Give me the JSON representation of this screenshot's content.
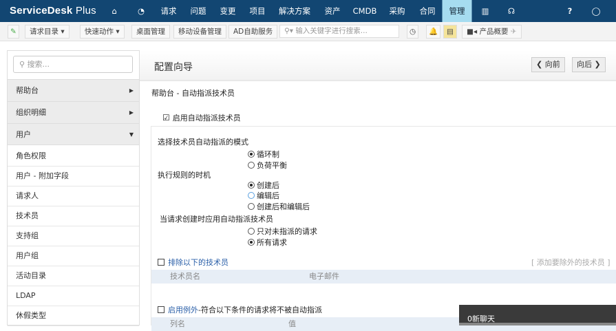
{
  "header": {
    "logo_main": "ServiceDesk",
    "logo_sub": "Plus",
    "nav": [
      "请求",
      "问题",
      "变更",
      "项目",
      "解决方案",
      "资产",
      "CMDB",
      "采购",
      "合同",
      "管理"
    ],
    "active": "管理"
  },
  "toolbar": {
    "request_catalog": "请求目录",
    "quick_actions": "快速动作",
    "desktop_mgmt": "桌面管理",
    "mobile_mgmt": "移动设备管理",
    "ad_self_service": "AD自助服务",
    "search_placeholder": "输入关键字进行搜索...",
    "product_overview": "产品概要"
  },
  "sidebar": {
    "search_placeholder": "搜索...",
    "groups": [
      "帮助台",
      "组织明细",
      "用户"
    ],
    "items": [
      "角色权限",
      "用户 - 附加字段",
      "请求人",
      "技术员",
      "支持组",
      "用户组",
      "活动目录",
      "LDAP",
      "休假类型"
    ]
  },
  "main": {
    "title": "配置向导",
    "prev": "向前",
    "next": "向后",
    "subtitle": "帮助台 - 自动指派技术员",
    "enable_label": "启用自动指派技术员",
    "mode_label": "选择技术员自动指派的模式",
    "mode_options": [
      "循环制",
      "负荷平衡"
    ],
    "timing_label": "执行规则的时机",
    "timing_options": [
      "创建后",
      "编辑后",
      "创建后和编辑后"
    ],
    "apply_label": "当请求创建时应用自动指派技术员",
    "apply_options": [
      "只对未指派的请求",
      "所有请求"
    ],
    "exclude_label": "排除以下的技术员",
    "exclude_add": "[ 添加要除外的技术员 ]",
    "exclude_cols": [
      "技术员名",
      "电子邮件"
    ],
    "exception_link": "启用例外",
    "exception_text": "-符合以下条件的请求将不被自动指派",
    "exception_cols": [
      "列名",
      "值"
    ]
  },
  "chat": {
    "label": "0新聊天"
  }
}
